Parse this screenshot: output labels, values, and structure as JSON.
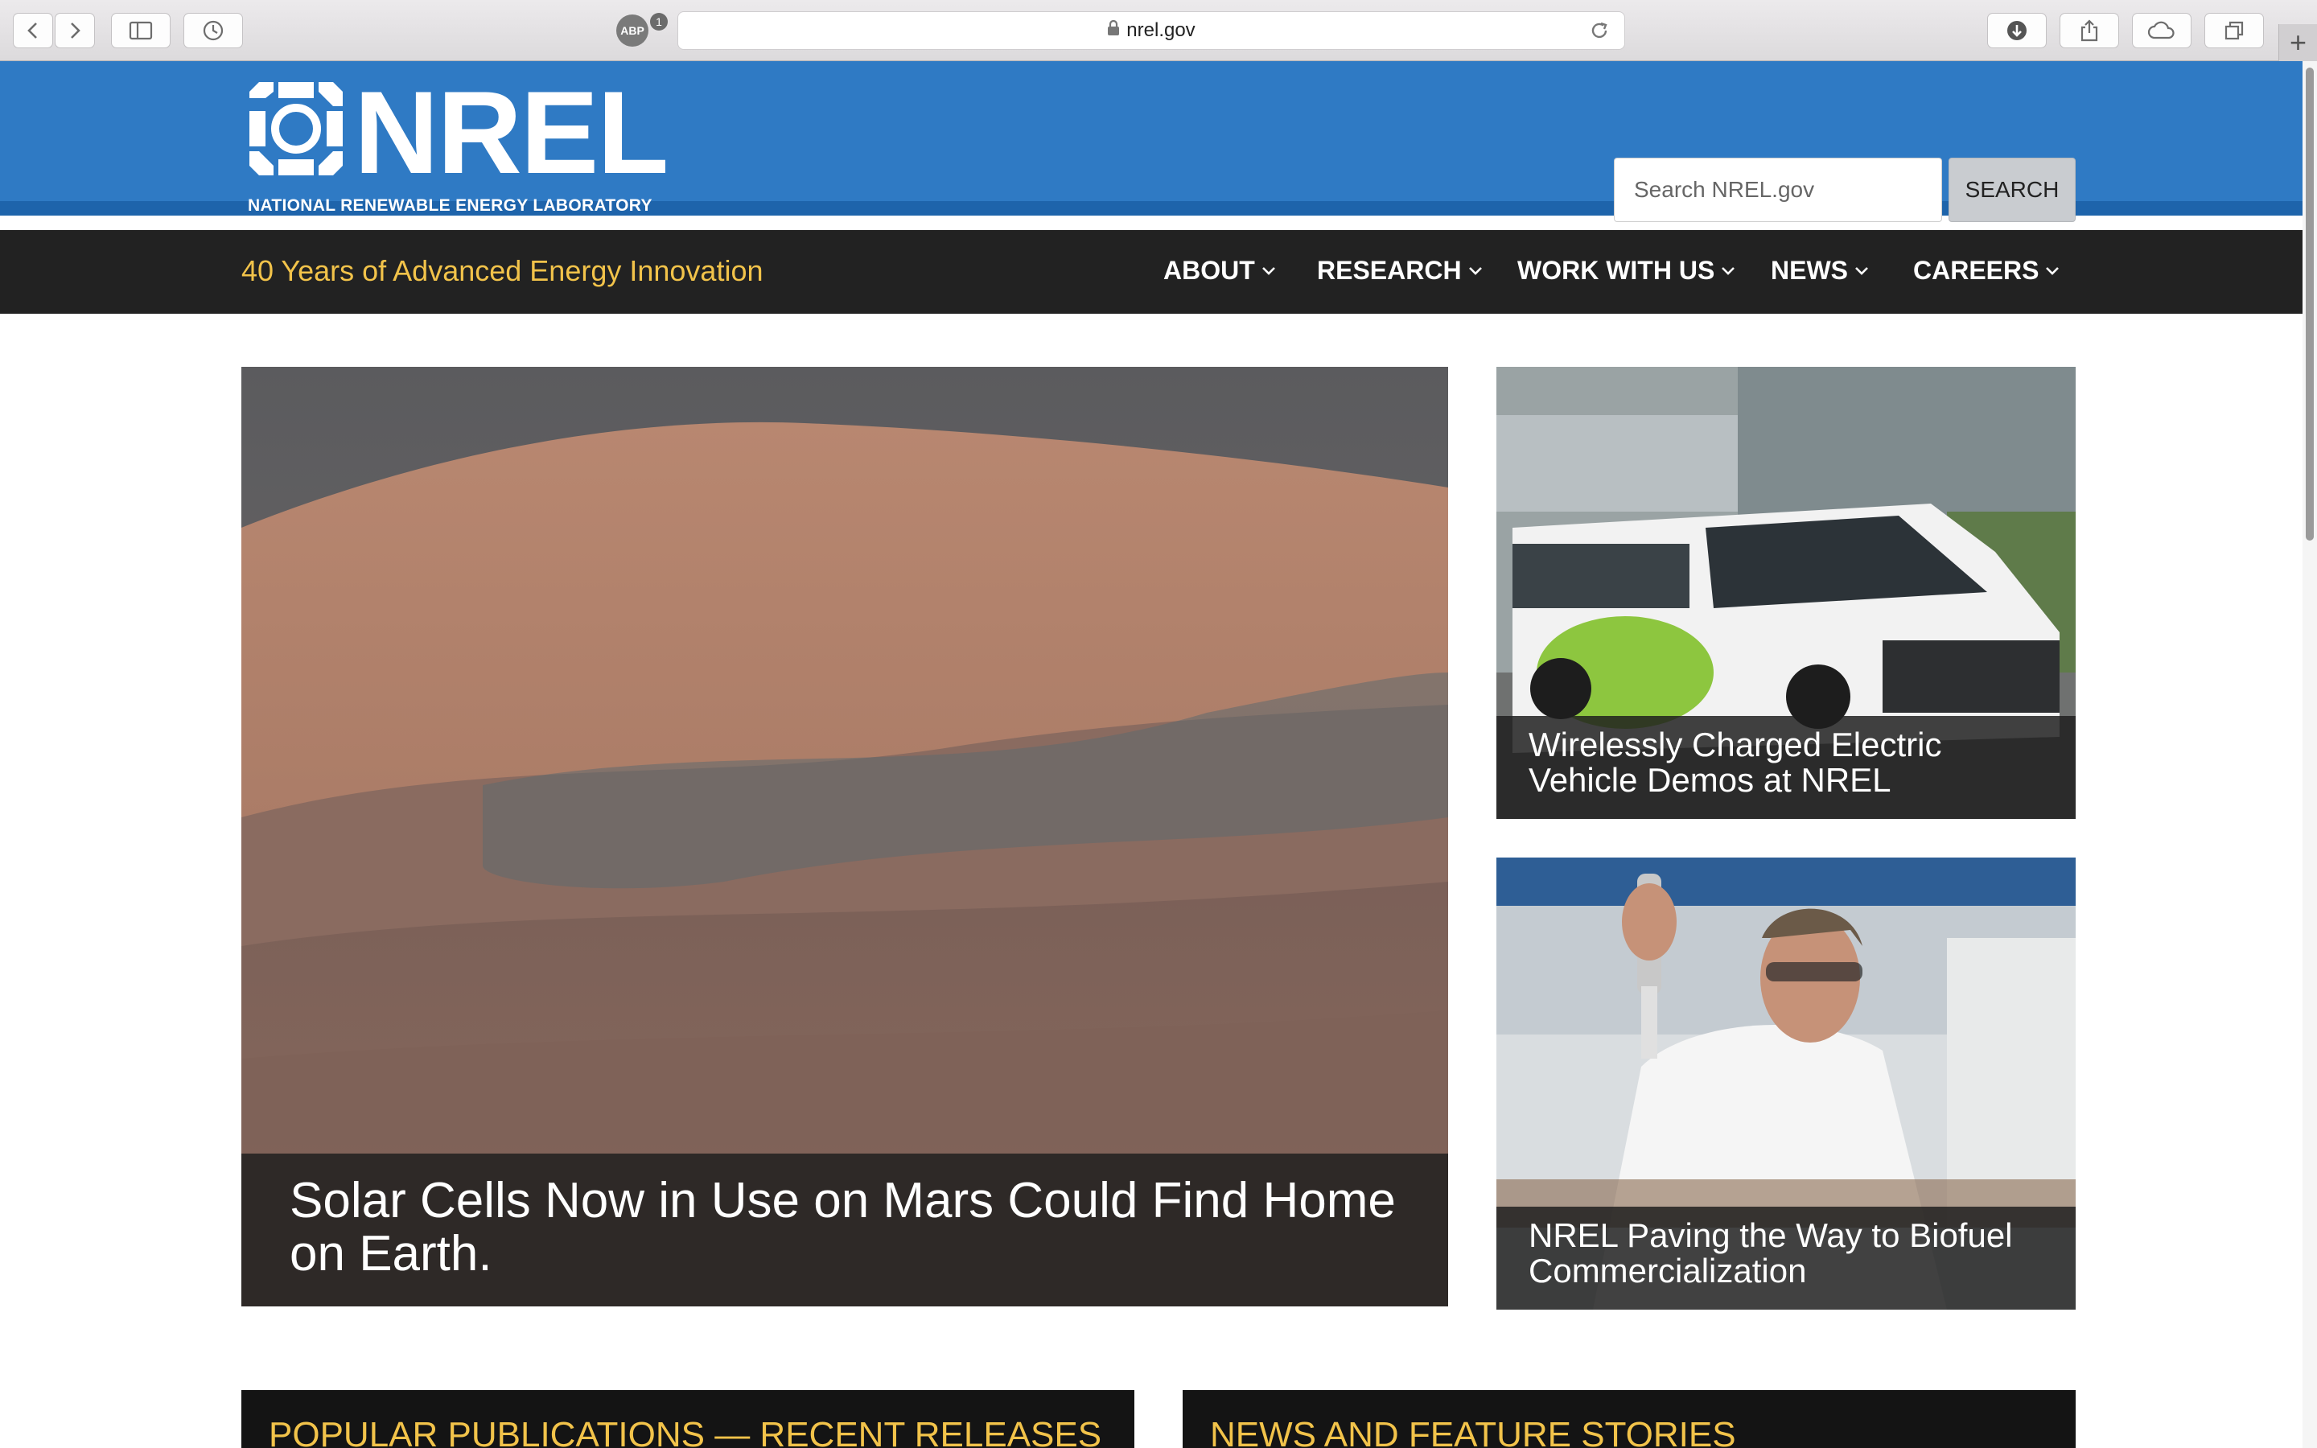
{
  "browser": {
    "url": "nrel.gov",
    "adblock_count": "1",
    "adblock_label": "ABP"
  },
  "header": {
    "logo_text": "NREL",
    "logo_subtitle": "NATIONAL RENEWABLE ENERGY LABORATORY",
    "search_placeholder": "Search NREL.gov",
    "search_button": "SEARCH"
  },
  "navbar": {
    "tagline": "40 Years of Advanced Energy Innovation",
    "items": [
      {
        "label": "ABOUT"
      },
      {
        "label": "RESEARCH"
      },
      {
        "label": "WORK WITH US"
      },
      {
        "label": "NEWS"
      },
      {
        "label": "CAREERS"
      }
    ]
  },
  "hero": {
    "caption": "Solar Cells Now in Use on Mars Could Find Home on Earth."
  },
  "cards": [
    {
      "caption": "Wirelessly Charged Electric Vehicle Demos at NREL"
    },
    {
      "caption": "NREL Paving the Way to Biofuel Commercialization"
    }
  ],
  "sections": [
    {
      "title": "POPULAR PUBLICATIONS — RECENT RELEASES"
    },
    {
      "title": "NEWS AND FEATURE STORIES"
    }
  ],
  "colors": {
    "header_blue": "#2f7ac4",
    "nav_dark": "#222222",
    "accent_gold": "#f2c34a"
  }
}
